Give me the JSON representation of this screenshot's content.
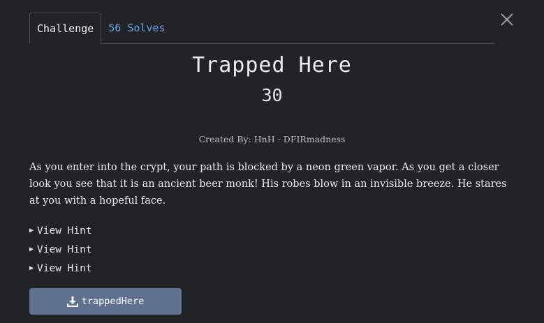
{
  "tabs": {
    "challenge": "Challenge",
    "solves": "56 Solves"
  },
  "challenge": {
    "name": "Trapped Here",
    "points": "30",
    "author": "Created By: HnH - DFIRmadness",
    "description": "As you enter into the crypt, your path is blocked by a neon green vapor. As you get a closer look you see that it is an ancient beer monk! His robes blow in an invisible breeze. He stares at you with a hopeful face."
  },
  "hints": [
    {
      "label": "View Hint"
    },
    {
      "label": "View Hint"
    },
    {
      "label": "View Hint"
    }
  ],
  "file": {
    "label": "trappedHere"
  },
  "icons": {
    "close": "close-icon",
    "download": "download-icon",
    "hint": "triangle-right-icon"
  },
  "colors": {
    "background": "#212327",
    "link": "#6fa3e8",
    "button": "#5f7390"
  }
}
